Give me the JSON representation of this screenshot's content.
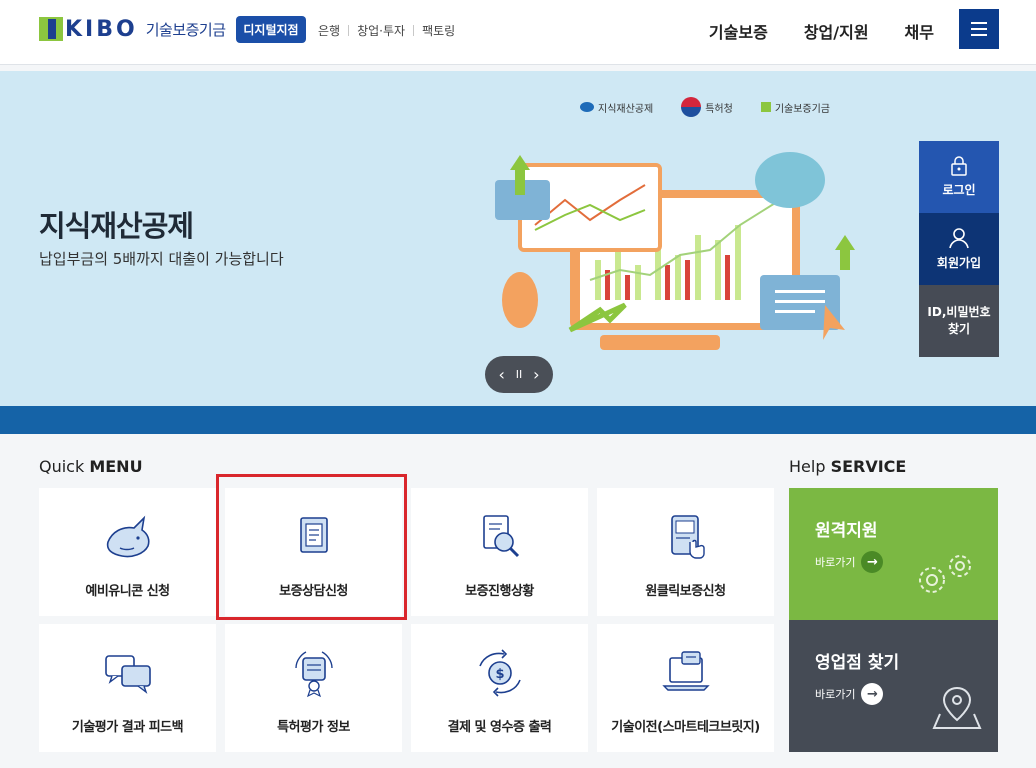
{
  "header": {
    "logo_text": "KIBO",
    "org_name": "기술보증기금",
    "digital_badge": "디지털지점",
    "subnav": [
      "은행",
      "창업·투자",
      "팩토링"
    ],
    "mainnav": [
      "기술보증",
      "창업/지원",
      "채무"
    ],
    "menu_icon": "hamburger-icon"
  },
  "banner": {
    "sponsors": [
      "지식재산공제",
      "특허청",
      "기술보증기금"
    ],
    "title": "지식재산공제",
    "subtitle": "납입부금의 5배까지 대출이 가능합니다",
    "controls": {
      "prev": "‹",
      "pause": "II",
      "next": "›"
    }
  },
  "side_quick": [
    {
      "label": "로그인",
      "icon": "lock-icon"
    },
    {
      "label": "회원가입",
      "icon": "user-icon"
    },
    {
      "label": "ID,비밀번호 찾기",
      "icon": ""
    }
  ],
  "quick_menu": {
    "title_light": "Quick ",
    "title_bold": "MENU",
    "items": [
      {
        "label": "예비유니콘 신청",
        "icon": "unicorn-icon"
      },
      {
        "label": "보증상담신청",
        "icon": "document-icon"
      },
      {
        "label": "보증진행상황",
        "icon": "document-search-icon"
      },
      {
        "label": "원클릭보증신청",
        "icon": "tablet-touch-icon"
      },
      {
        "label": "기술평가 결과 피드백",
        "icon": "chat-bubbles-icon"
      },
      {
        "label": "특허평가 정보",
        "icon": "award-icon"
      },
      {
        "label": "결제 및 영수증 출력",
        "icon": "payment-cycle-icon"
      },
      {
        "label": "기술이전(스마트테크브릿지)",
        "icon": "laptop-chat-icon"
      }
    ],
    "highlighted_index": 1,
    "highlight_color": "#d9262c"
  },
  "help_service": {
    "title_light": "Help ",
    "title_bold": "SERVICE",
    "cards": [
      {
        "title": "원격지원",
        "go": "바로가기",
        "icon": "gears-icon",
        "color": "#7bb843"
      },
      {
        "title": "영업점 찾기",
        "go": "바로가기",
        "icon": "map-pin-icon",
        "color": "#454b55"
      }
    ]
  }
}
